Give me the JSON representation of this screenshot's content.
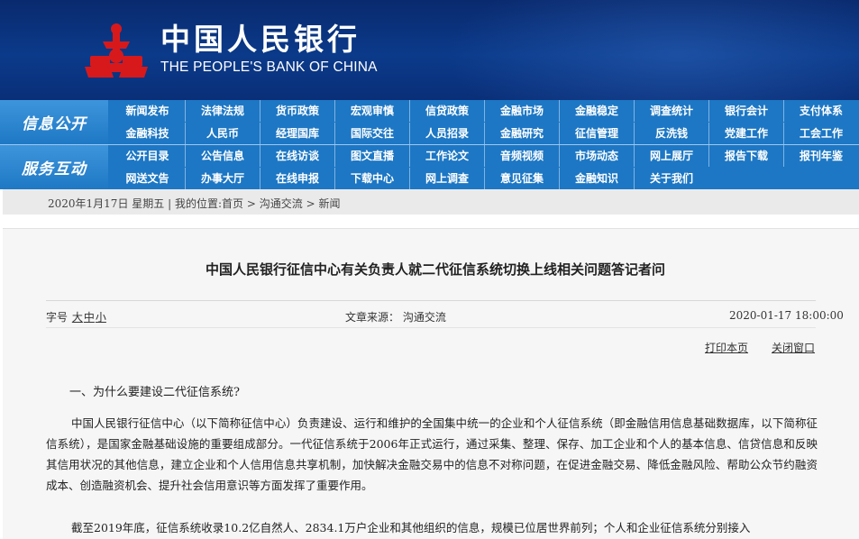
{
  "header": {
    "bank_name_cn": "中国人民银行",
    "bank_name_en": "THE PEOPLE'S BANK OF CHINA",
    "emblem_icon": "pboc-emblem-icon",
    "colors": {
      "header_bg": "#0b3a8a",
      "nav_bg": "#1d77c4",
      "emblem_red": "#d7191c"
    }
  },
  "nav": {
    "section1_label": "信息公开",
    "section2_label": "服务互动",
    "rows": [
      [
        "新闻发布",
        "法律法规",
        "货币政策",
        "宏观审慎",
        "信贷政策",
        "金融市场",
        "金融稳定",
        "调查统计",
        "银行会计",
        "支付体系"
      ],
      [
        "金融科技",
        "人民币",
        "经理国库",
        "国际交往",
        "人员招录",
        "金融研究",
        "征信管理",
        "反洗钱",
        "党建工作",
        "工会工作"
      ],
      [
        "公开目录",
        "公告信息",
        "在线访谈",
        "图文直播",
        "工作论文",
        "音频视频",
        "市场动态",
        "网上展厅",
        "报告下载",
        "报刊年鉴"
      ],
      [
        "网送文告",
        "办事大厅",
        "在线申报",
        "下载中心",
        "网上调查",
        "意见征集",
        "金融知识",
        "关于我们"
      ]
    ]
  },
  "breadcrumb": {
    "date": "2020年1月17日 星期五",
    "sep": "|",
    "location_prefix": "我的位置:",
    "items": [
      "首页",
      "沟通交流",
      "新闻"
    ]
  },
  "article": {
    "title": "中国人民银行征信中心有关负责人就二代征信系统切换上线相关问题答记者问",
    "font_size_label": "字号",
    "font_sizes": [
      "大",
      "中",
      "小"
    ],
    "source": "文章来源：  沟通交流",
    "datetime": "2020-01-17 18:00:00",
    "print_label": "打印本页",
    "close_label": "关闭窗口",
    "section_heading": "一、为什么要建设二代征信系统?",
    "paragraph1": "中国人民银行征信中心（以下简称征信中心）负责建设、运行和维护的全国集中统一的企业和个人征信系统（即金融信用信息基础数据库，以下简称征信系统），是国家金融基础设施的重要组成部分。一代征信系统于2006年正式运行，通过采集、整理、保存、加工企业和个人的基本信息、信贷信息和反映其信用状况的其他信息，建立企业和个人信用信息共享机制，加快解决金融交易中的信息不对称问题，在促进金融交易、降低金融风险、帮助公众节约融资成本、创造融资机会、提升社会信用意识等方面发挥了重要作用。",
    "paragraph2": "截至2019年底，征信系统收录10.2亿自然人、2834.1万户企业和其他组织的信息，规模已位居世界前列；个人和企业征信系统分别接入"
  }
}
